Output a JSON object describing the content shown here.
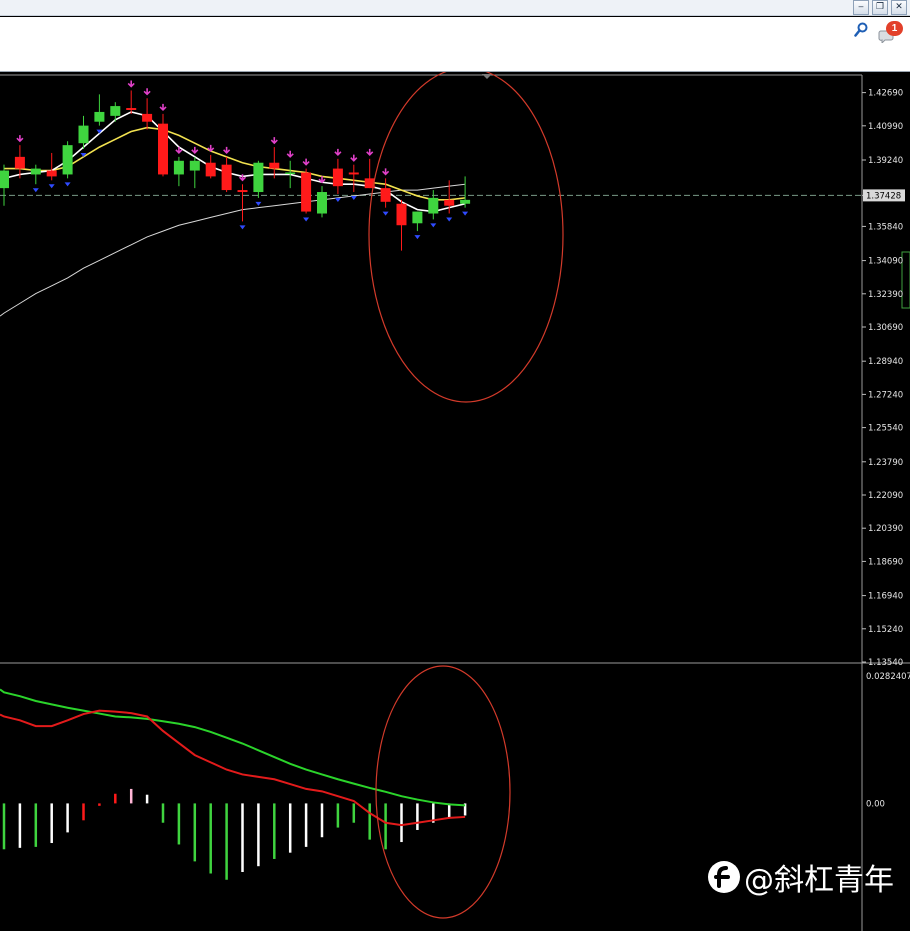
{
  "window": {
    "buttons": [
      {
        "name": "minimize",
        "glyph": "‒"
      },
      {
        "name": "restore",
        "glyph": "❐"
      },
      {
        "name": "close",
        "glyph": "✕"
      }
    ],
    "notification_count": "1"
  },
  "price_axis": {
    "labels": [
      "1.42690",
      "1.40990",
      "1.39240",
      "1.37428",
      "1.35840",
      "1.34090",
      "1.32390",
      "1.30690",
      "1.28940",
      "1.27240",
      "1.25540",
      "1.23790",
      "1.22090",
      "1.20390",
      "1.18690",
      "1.16940",
      "1.15240",
      "1.13540"
    ],
    "current_price": "1.37428"
  },
  "indicator_axis": {
    "top_label": "0.0282407",
    "zero_label": "0.00"
  },
  "watermark": {
    "text": "@斜杠青年"
  },
  "colors": {
    "background": "#000000",
    "bull_candle": "#3fd43f",
    "bear_candle": "#ff1a1a",
    "fast_ma": "#ffffff",
    "slow_ma": "#f2e250",
    "long_ma": "#d8d8d8",
    "signal_line_green": "#2bd42b",
    "macd_line_red": "#e31b1b",
    "annotation_circle": "#d23a2a",
    "fractal_up": "#e040c8",
    "fractal_down": "#2f4bff"
  },
  "chart_data": {
    "type": "candlestick",
    "main_panel": {
      "ylim": [
        1.1354,
        1.4354
      ],
      "candles": [
        {
          "o": 1.378,
          "h": 1.39,
          "l": 1.369,
          "c": 1.387
        },
        {
          "o": 1.394,
          "h": 1.4,
          "l": 1.383,
          "c": 1.388
        },
        {
          "o": 1.385,
          "h": 1.39,
          "l": 1.38,
          "c": 1.388
        },
        {
          "o": 1.387,
          "h": 1.396,
          "l": 1.382,
          "c": 1.384
        },
        {
          "o": 1.385,
          "h": 1.402,
          "l": 1.383,
          "c": 1.4
        },
        {
          "o": 1.401,
          "h": 1.415,
          "l": 1.398,
          "c": 1.41
        },
        {
          "o": 1.412,
          "h": 1.426,
          "l": 1.41,
          "c": 1.417
        },
        {
          "o": 1.415,
          "h": 1.422,
          "l": 1.412,
          "c": 1.42
        },
        {
          "o": 1.419,
          "h": 1.428,
          "l": 1.416,
          "c": 1.418
        },
        {
          "o": 1.416,
          "h": 1.424,
          "l": 1.408,
          "c": 1.412
        },
        {
          "o": 1.411,
          "h": 1.416,
          "l": 1.384,
          "c": 1.385
        },
        {
          "o": 1.385,
          "h": 1.394,
          "l": 1.379,
          "c": 1.392
        },
        {
          "o": 1.387,
          "h": 1.394,
          "l": 1.378,
          "c": 1.392
        },
        {
          "o": 1.391,
          "h": 1.395,
          "l": 1.383,
          "c": 1.384
        },
        {
          "o": 1.39,
          "h": 1.394,
          "l": 1.376,
          "c": 1.377
        },
        {
          "o": 1.377,
          "h": 1.38,
          "l": 1.361,
          "c": 1.376
        },
        {
          "o": 1.376,
          "h": 1.392,
          "l": 1.373,
          "c": 1.391
        },
        {
          "o": 1.391,
          "h": 1.399,
          "l": 1.383,
          "c": 1.388
        },
        {
          "o": 1.386,
          "h": 1.392,
          "l": 1.378,
          "c": 1.386
        },
        {
          "o": 1.386,
          "h": 1.388,
          "l": 1.365,
          "c": 1.366
        },
        {
          "o": 1.365,
          "h": 1.379,
          "l": 1.363,
          "c": 1.376
        },
        {
          "o": 1.388,
          "h": 1.393,
          "l": 1.375,
          "c": 1.379
        },
        {
          "o": 1.386,
          "h": 1.39,
          "l": 1.376,
          "c": 1.385
        },
        {
          "o": 1.383,
          "h": 1.393,
          "l": 1.378,
          "c": 1.378
        },
        {
          "o": 1.378,
          "h": 1.383,
          "l": 1.368,
          "c": 1.371
        },
        {
          "o": 1.37,
          "h": 1.372,
          "l": 1.346,
          "c": 1.359
        },
        {
          "o": 1.36,
          "h": 1.366,
          "l": 1.356,
          "c": 1.366
        },
        {
          "o": 1.365,
          "h": 1.377,
          "l": 1.362,
          "c": 1.373
        },
        {
          "o": 1.372,
          "h": 1.382,
          "l": 1.365,
          "c": 1.369
        },
        {
          "o": 1.37,
          "h": 1.384,
          "l": 1.368,
          "c": 1.372
        }
      ],
      "fast_ma": [
        1.383,
        1.385,
        1.386,
        1.387,
        1.392,
        1.399,
        1.406,
        1.413,
        1.417,
        1.415,
        1.407,
        1.399,
        1.394,
        1.389,
        1.386,
        1.384,
        1.385,
        1.385,
        1.385,
        1.383,
        1.381,
        1.38,
        1.38,
        1.379,
        1.377,
        1.371,
        1.367,
        1.366,
        1.368,
        1.37
      ],
      "slow_ma": [
        1.388,
        1.388,
        1.387,
        1.387,
        1.389,
        1.394,
        1.399,
        1.403,
        1.407,
        1.409,
        1.408,
        1.405,
        1.401,
        1.397,
        1.394,
        1.391,
        1.389,
        1.388,
        1.387,
        1.386,
        1.384,
        1.383,
        1.382,
        1.381,
        1.38,
        1.377,
        1.374,
        1.372,
        1.372,
        1.373
      ],
      "long_ma": [
        1.314,
        1.319,
        1.324,
        1.328,
        1.332,
        1.337,
        1.341,
        1.345,
        1.349,
        1.353,
        1.356,
        1.359,
        1.361,
        1.363,
        1.365,
        1.367,
        1.368,
        1.369,
        1.37,
        1.371,
        1.372,
        1.373,
        1.374,
        1.375,
        1.376,
        1.377,
        1.377,
        1.378,
        1.379,
        1.38
      ],
      "up_fractal_idx": [
        1,
        8,
        9,
        10,
        11,
        12,
        13,
        14,
        15,
        17,
        18,
        19,
        20,
        21,
        22,
        23,
        24
      ],
      "down_fractal_idx": [
        2,
        3,
        4,
        5,
        6,
        15,
        16,
        19,
        21,
        22,
        24,
        26,
        27,
        28,
        29
      ]
    },
    "indicator_panel": {
      "ylim": [
        -0.026,
        0.0282407
      ],
      "histogram": [
        -0.0095,
        -0.0092,
        -0.009,
        -0.0082,
        -0.006,
        -0.0035,
        -0.0005,
        0.002,
        0.003,
        0.0018,
        -0.004,
        -0.0085,
        -0.012,
        -0.0145,
        -0.0158,
        -0.0142,
        -0.013,
        -0.0115,
        -0.0102,
        -0.009,
        -0.007,
        -0.005,
        -0.004,
        -0.0075,
        -0.0095,
        -0.008,
        -0.0055,
        -0.004,
        -0.003,
        -0.0025
      ],
      "histogram_colors": [
        "#3fd43f",
        "#ffffff",
        "#3fd43f",
        "#ffffff",
        "#ffffff",
        "#ff1a1a",
        "#ff1a1a",
        "#ff1a1a",
        "#ffb6d6",
        "#ffffff",
        "#3fd43f",
        "#3fd43f",
        "#3fd43f",
        "#3fd43f",
        "#3fd43f",
        "#ffffff",
        "#ffffff",
        "#3fd43f",
        "#ffffff",
        "#ffffff",
        "#ffffff",
        "#3fd43f",
        "#3fd43f",
        "#3fd43f",
        "#3fd43f",
        "#ffffff",
        "#ffffff",
        "#ffffff",
        "#ffffff",
        "#ffffff"
      ],
      "signal_line": [
        0.023,
        0.0222,
        0.0212,
        0.0205,
        0.0198,
        0.0192,
        0.0186,
        0.018,
        0.0178,
        0.0175,
        0.017,
        0.0165,
        0.0158,
        0.0148,
        0.0136,
        0.0124,
        0.011,
        0.0096,
        0.0082,
        0.007,
        0.006,
        0.005,
        0.0041,
        0.0032,
        0.0024,
        0.0015,
        0.0008,
        0.0002,
        -0.0002,
        -0.0004
      ],
      "macd_line": [
        0.018,
        0.0172,
        0.016,
        0.016,
        0.0172,
        0.0185,
        0.0192,
        0.019,
        0.0187,
        0.018,
        0.015,
        0.0125,
        0.01,
        0.0085,
        0.007,
        0.006,
        0.0055,
        0.005,
        0.004,
        0.003,
        0.0025,
        0.0015,
        0.0005,
        -0.002,
        -0.004,
        -0.0045,
        -0.004,
        -0.0035,
        -0.003,
        -0.0028
      ]
    }
  }
}
